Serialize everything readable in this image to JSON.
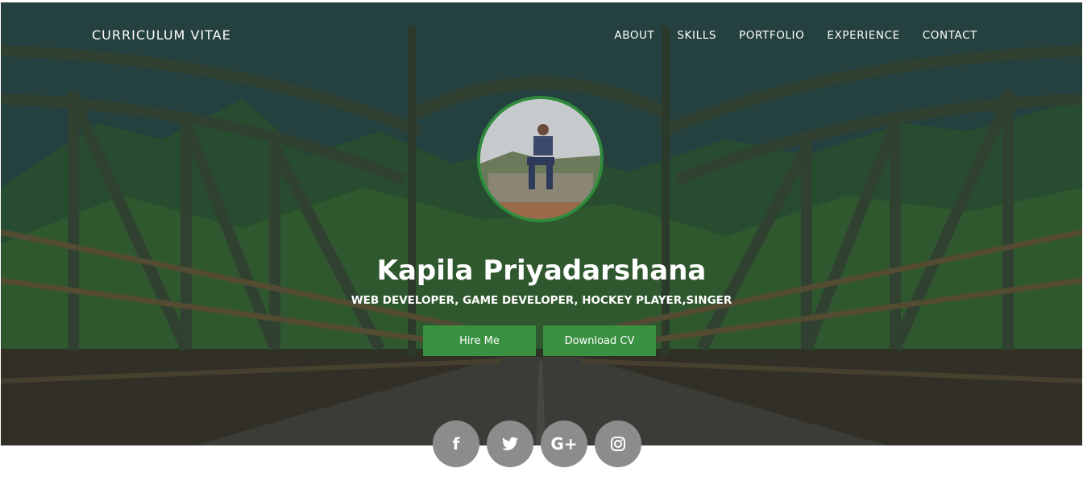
{
  "nav": {
    "brand": "CURRICULUM VITAE",
    "items": [
      "ABOUT",
      "SKILLS",
      "PORTFOLIO",
      "EXPERIENCE",
      "CONTACT"
    ]
  },
  "hero": {
    "name": "Kapila Priyadarshana",
    "tagline": "WEB DEVELOPER, GAME DEVELOPER, HOCKEY PLAYER,SINGER",
    "buttons": {
      "hire": "Hire Me",
      "download": "Download CV"
    }
  },
  "social": {
    "facebook": {
      "icon": "facebook-icon",
      "glyph": "f"
    },
    "twitter": {
      "icon": "twitter-icon"
    },
    "googleplus": {
      "icon": "google-plus-icon",
      "glyph": "G+"
    },
    "instagram": {
      "icon": "instagram-icon"
    }
  },
  "colors": {
    "accent": "#3a9142",
    "avatar_border": "#2f8a3c",
    "social_bg": "#8c8c8c"
  }
}
